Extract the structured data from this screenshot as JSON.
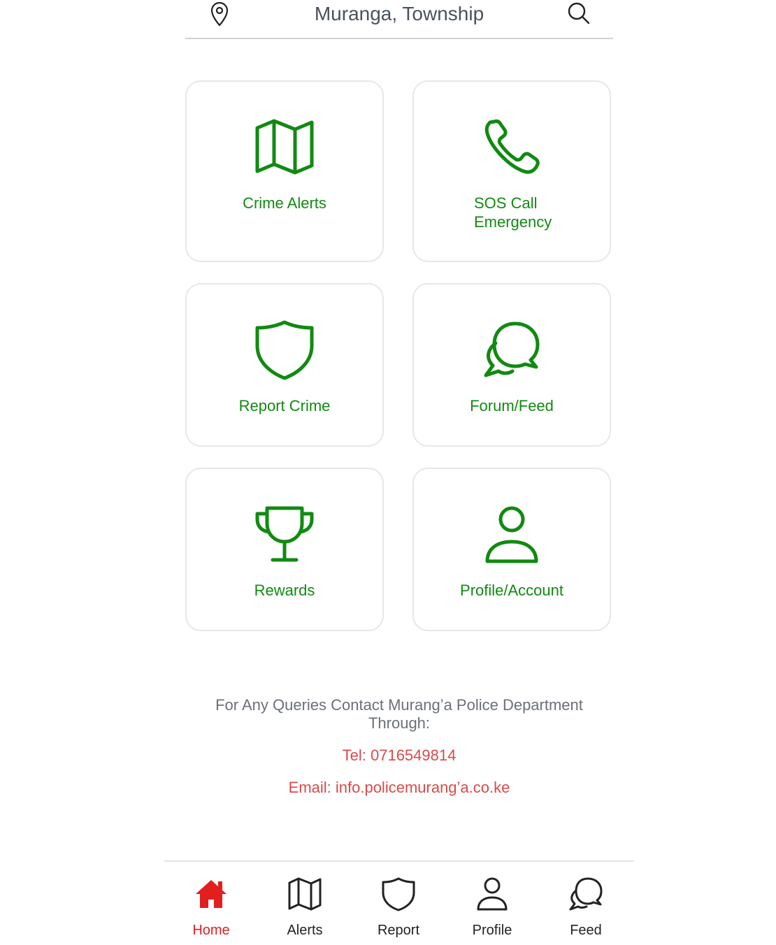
{
  "header": {
    "location_title": "Muranga, Township",
    "location_icon": "map-pin-icon",
    "search_icon": "search-icon"
  },
  "tiles": [
    {
      "label": "Crime Alerts",
      "icon": "map-icon"
    },
    {
      "label_line1": "SOS Call",
      "label_line2": "Emergency",
      "icon": "phone-icon"
    },
    {
      "label": "Report Crime",
      "icon": "shield-icon"
    },
    {
      "label": "Forum/Feed",
      "icon": "chat-bubbles-icon"
    },
    {
      "label": "Rewards",
      "icon": "trophy-icon"
    },
    {
      "label": "Profile/Account",
      "icon": "user-icon"
    }
  ],
  "contact": {
    "query_text": "For Any Queries Contact Murang’a Police Department Through:",
    "tel": "Tel: 0716549814",
    "email": "Email: info.policemurang’a.co.ke"
  },
  "bottom_nav": {
    "items": [
      {
        "label": "Home",
        "icon": "home-icon",
        "active": true
      },
      {
        "label": "Alerts",
        "icon": "map-icon",
        "active": false
      },
      {
        "label": "Report",
        "icon": "shield-icon",
        "active": false
      },
      {
        "label": "Profile",
        "icon": "user-icon",
        "active": false
      },
      {
        "label": "Feed",
        "icon": "chat-bubbles-icon",
        "active": false
      }
    ]
  },
  "colors": {
    "accent_green": "#118a11",
    "active_red": "#e21f1f",
    "contact_red": "#d94a4a",
    "muted_text": "#6b7079"
  }
}
